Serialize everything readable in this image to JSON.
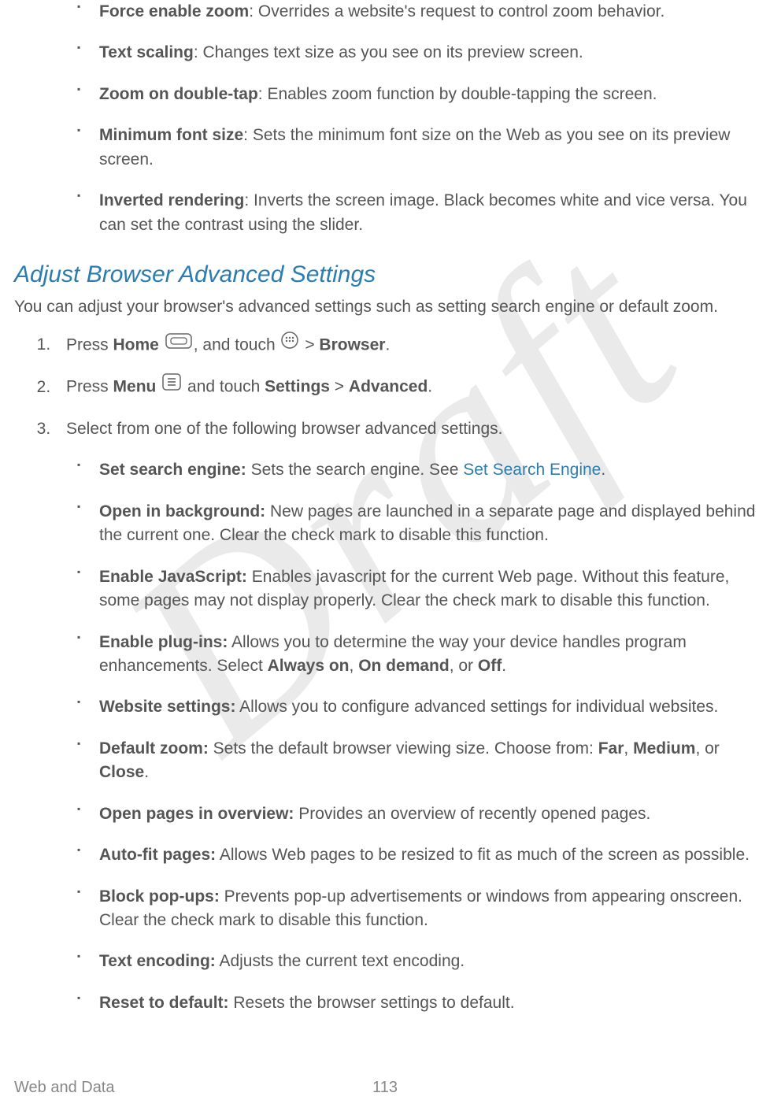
{
  "watermark": "Draft",
  "top_bullets": [
    {
      "term": "Force enable zoom",
      "desc": ": Overrides a website's request to control zoom behavior."
    },
    {
      "term": "Text scaling",
      "desc": ": Changes text size as you see on its preview screen."
    },
    {
      "term": "Zoom on double-tap",
      "desc": ": Enables zoom function by double-tapping the screen."
    },
    {
      "term": "Minimum font size",
      "desc": ": Sets the minimum font size on the Web as you see on its preview screen."
    },
    {
      "term": "Inverted rendering",
      "desc": ": Inverts the screen image. Black becomes white and vice versa. You can set the contrast using the slider."
    }
  ],
  "section_heading": "Adjust Browser Advanced Settings",
  "section_intro": "You can adjust your browser's advanced settings such as setting search engine or default zoom.",
  "steps": {
    "s1_a": "Press ",
    "s1_home": "Home",
    "s1_b": ", and touch ",
    "s1_c": " > ",
    "s1_browser": "Browser",
    "s1_d": ".",
    "s2_a": "Press ",
    "s2_menu": "Menu",
    "s2_b": " and touch ",
    "s2_settings": "Settings",
    "s2_c": " > ",
    "s2_advanced": "Advanced",
    "s2_d": ".",
    "s3": "Select from one of the following browser advanced settings."
  },
  "adv_bullets": [
    {
      "term": "Set search engine:",
      "desc": " Sets the search engine. See ",
      "link": "Set Search Engine",
      "desc_after": "."
    },
    {
      "term": "Open in background:",
      "desc": " New pages are launched in a separate page and displayed behind the current one. Clear the check mark to disable this function."
    },
    {
      "term": "Enable JavaScript:",
      "desc": " Enables javascript for the current Web page. Without this feature, some pages may not display properly. Clear the check mark to disable this function."
    },
    {
      "term": "Enable plug-ins:",
      "desc_a": " Allows you to determine the way your device handles program enhancements. Select ",
      "opt1": "Always on",
      "sep1": ", ",
      "opt2": "On demand",
      "sep2": ", or ",
      "opt3": "Off",
      "desc_b": "."
    },
    {
      "term": "Website settings:",
      "desc": " Allows you to configure advanced settings for individual websites."
    },
    {
      "term": "Default zoom:",
      "desc_a": " Sets the default browser viewing size. Choose from: ",
      "opt1": "Far",
      "sep1": ", ",
      "opt2": "Medium",
      "sep2": ", or ",
      "opt3": "Close",
      "desc_b": "."
    },
    {
      "term": "Open pages in overview:",
      "desc": " Provides an overview of recently opened pages."
    },
    {
      "term": "Auto-fit pages:",
      "desc": " Allows Web pages to be resized to fit as much of the screen as possible."
    },
    {
      "term": "Block pop-ups:",
      "desc": " Prevents pop-up advertisements or windows from appearing onscreen. Clear the check mark to disable this function."
    },
    {
      "term": "Text encoding:",
      "desc": " Adjusts the current text encoding."
    },
    {
      "term": "Reset to default:",
      "desc": " Resets the browser settings to default."
    }
  ],
  "footer": {
    "left": "Web and Data",
    "page": "113"
  }
}
